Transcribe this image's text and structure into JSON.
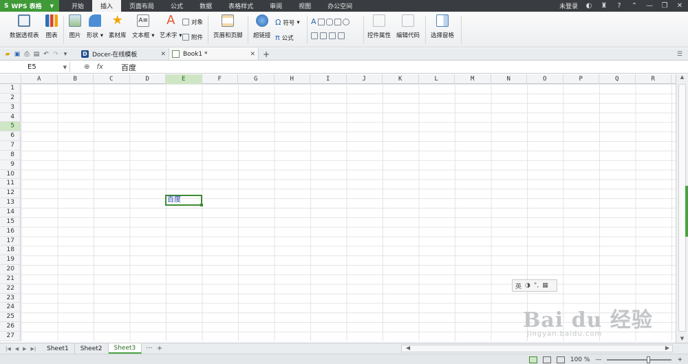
{
  "app": {
    "name": "WPS 表格"
  },
  "menu": [
    "开始",
    "插入",
    "页面布局",
    "公式",
    "数据",
    "表格样式",
    "审阅",
    "视图",
    "办公空间"
  ],
  "menu_active": "插入",
  "account": {
    "login": "未登录"
  },
  "ribbon": {
    "pivot": "数据透视表",
    "chart": "图表",
    "picture": "图片",
    "shape": "形状",
    "material": "素材库",
    "textbox": "文本框",
    "wordart": "艺术字",
    "object": "对象",
    "attachment": "附件",
    "header_footer": "页眉和页脚",
    "hyperlink": "超链接",
    "symbol": "符号",
    "formula": "公式",
    "control_props": "控件属性",
    "edit_code": "编辑代码",
    "select_pane": "选择窗格"
  },
  "tabs": [
    {
      "label": "Docer-在线模板"
    },
    {
      "label": "Book1 *"
    }
  ],
  "formula_bar": {
    "cell_ref": "E5",
    "fx": "fx",
    "value": "百度"
  },
  "columns": [
    "A",
    "B",
    "C",
    "D",
    "E",
    "F",
    "G",
    "H",
    "I",
    "J",
    "K",
    "L",
    "M",
    "N",
    "O",
    "P",
    "Q",
    "R"
  ],
  "rows": [
    "1",
    "2",
    "3",
    "4",
    "5",
    "6",
    "7",
    "8",
    "9",
    "10",
    "11",
    "12",
    "13",
    "14",
    "15",
    "16",
    "17",
    "18",
    "19",
    "20",
    "21",
    "22",
    "23",
    "24",
    "25",
    "26",
    "27"
  ],
  "cells": {
    "E5": "百度"
  },
  "selected": {
    "col": "E",
    "row": "5"
  },
  "ime": {
    "label": "英"
  },
  "watermark": {
    "logo": "Bai du 经验",
    "url": "jingyan.baidu.com"
  },
  "sheets": [
    "Sheet1",
    "Sheet2",
    "Sheet3"
  ],
  "active_sheet": "Sheet3",
  "status": {
    "zoom": "100 %"
  },
  "colors": {
    "accent": "#3f9a37",
    "titlebar": "#393c40",
    "selection": "#cfe6c5"
  }
}
